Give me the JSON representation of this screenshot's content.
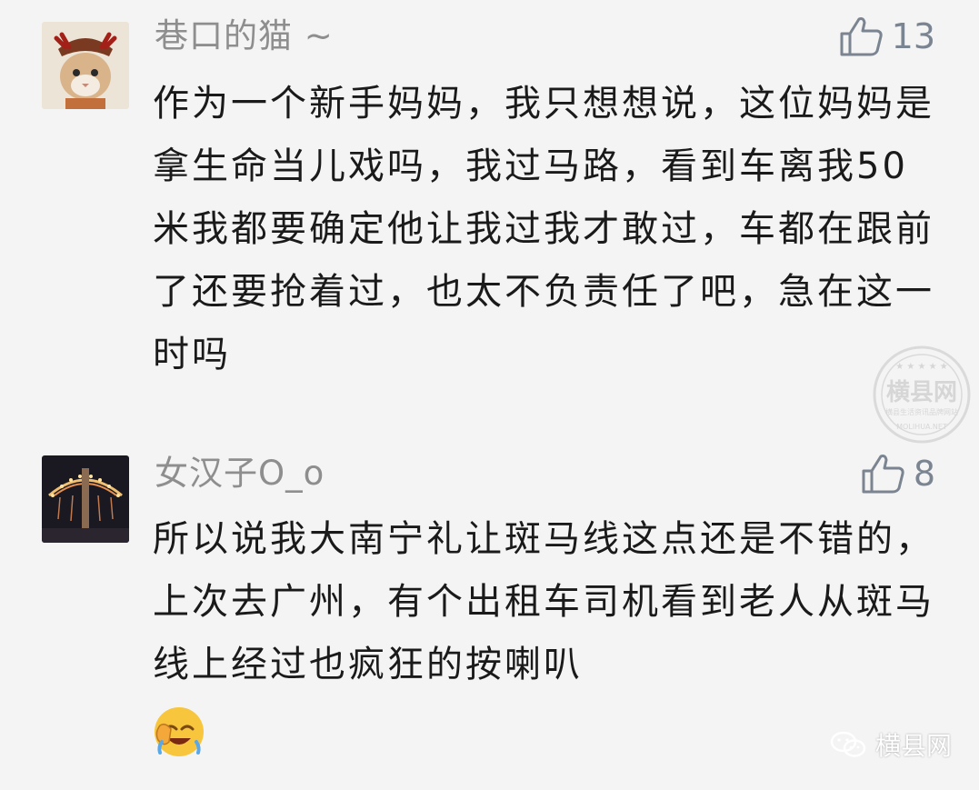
{
  "comments": [
    {
      "username": "巷口的猫 ~",
      "likes": "13",
      "text": "作为一个新手妈妈，我只想想说，这位妈妈是拿生命当儿戏吗，我过马路，看到车离我50米我都要确定他让我过我才敢过，车都在跟前了还要抢着过，也太不负责任了吧，急在这一时吗"
    },
    {
      "username": "女汉子O_o",
      "likes": "8",
      "text": "所以说我大南宁礼让斑马线这点还是不错的，上次去广州，有个出租车司机看到老人从斑马线上经过也疯狂的按喇叭"
    }
  ],
  "watermark": {
    "circle_title": "横县网",
    "circle_subtitle": "横县生活资讯品牌网站",
    "circle_url": "MOLIHUA.NET",
    "footer_brand": "横县网"
  },
  "icons": {
    "like": "thumbs-up-icon",
    "emoji": "facepalm-laugh-emoji-icon",
    "wechat": "wechat-icon"
  }
}
